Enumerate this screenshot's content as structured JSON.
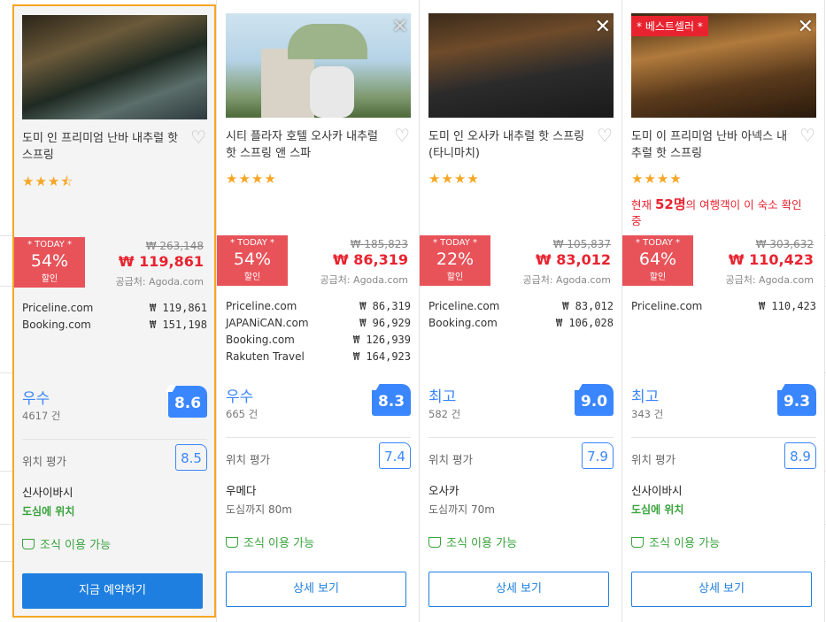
{
  "hotels": [
    {
      "name": "도미 인 프리미엄 난바 내추럴 핫 스프링",
      "stars": "★★★⯪",
      "deal": {
        "tag": "* TODAY *",
        "percent": "54%",
        "label": "할인",
        "old_price": "₩ 263,148",
        "new_price": "₩ 119,861",
        "supplier": "공급처: Agoda.com"
      },
      "prices": [
        {
          "site": "Priceline.com",
          "price": "₩ 119,861"
        },
        {
          "site": "Booking.com",
          "price": "₩ 151,198"
        }
      ],
      "rating": {
        "word": "우수",
        "count": "4617 건",
        "score": "8.6"
      },
      "location": {
        "label": "위치 평가",
        "score": "8.5"
      },
      "area": {
        "name": "신사이바시",
        "detail": "도심에 위치"
      },
      "breakfast": "조식 이용 가능",
      "button": "지금 예약하기"
    },
    {
      "name": "시티 플라자 호텔 오사카 내추럴 핫 스프링 앤 스파",
      "stars": "★★★★",
      "deal": {
        "tag": "* TODAY *",
        "percent": "54%",
        "label": "할인",
        "old_price": "₩ 185,823",
        "new_price": "₩ 86,319",
        "supplier": "공급처: Agoda.com"
      },
      "prices": [
        {
          "site": "Priceline.com",
          "price": "₩ 86,319"
        },
        {
          "site": "JAPANiCAN.com",
          "price": "₩ 96,929"
        },
        {
          "site": "Booking.com",
          "price": "₩ 126,939"
        },
        {
          "site": "Rakuten Travel",
          "price": "₩ 164,923"
        }
      ],
      "rating": {
        "word": "우수",
        "count": "665 건",
        "score": "8.3"
      },
      "location": {
        "label": "위치 평가",
        "score": "7.4"
      },
      "area": {
        "name": "우메다",
        "detail": "도심까지 80m"
      },
      "breakfast": "조식 이용 가능",
      "button": "상세 보기",
      "close": "✕"
    },
    {
      "name": "도미 인 오사카 내추럴 핫 스프링 (타니마치)",
      "stars": "★★★★",
      "deal": {
        "tag": "* TODAY *",
        "percent": "22%",
        "label": "할인",
        "old_price": "₩ 105,837",
        "new_price": "₩ 83,012",
        "supplier": "공급처: Agoda.com"
      },
      "prices": [
        {
          "site": "Priceline.com",
          "price": "₩ 83,012"
        },
        {
          "site": "Booking.com",
          "price": "₩ 106,028"
        }
      ],
      "rating": {
        "word": "최고",
        "count": "582 건",
        "score": "9.0"
      },
      "location": {
        "label": "위치 평가",
        "score": "7.9"
      },
      "area": {
        "name": "오사카",
        "detail": "도심까지 70m"
      },
      "breakfast": "조식 이용 가능",
      "button": "상세 보기",
      "close": "✕"
    },
    {
      "name": "도미 이 프리미엄 난바 아넥스 내추럴 핫 스프링",
      "stars": "★★★★",
      "bestseller": "* 베스트셀러 *",
      "urgent": {
        "pre": "현재 ",
        "num": "52명",
        "post": "의 여행객이 이 숙소 확인 중"
      },
      "deal": {
        "tag": "* TODAY *",
        "percent": "64%",
        "label": "할인",
        "old_price": "₩ 303,632",
        "new_price": "₩ 110,423",
        "supplier": "공급처: Agoda.com"
      },
      "prices": [
        {
          "site": "Priceline.com",
          "price": "₩ 110,423"
        }
      ],
      "rating": {
        "word": "최고",
        "count": "343 건",
        "score": "9.3"
      },
      "location": {
        "label": "위치 평가",
        "score": "8.9"
      },
      "area": {
        "name": "신사이바시",
        "detail": "도심에 위치"
      },
      "breakfast": "조식 이용 가능",
      "button": "상세 보기",
      "close": "✕"
    }
  ],
  "colors": {
    "accent": "#1e7fe0",
    "discount": "#e8535a",
    "rating": "#3a86ff",
    "highlight_border": "#f5a623",
    "green": "#39a33c"
  }
}
